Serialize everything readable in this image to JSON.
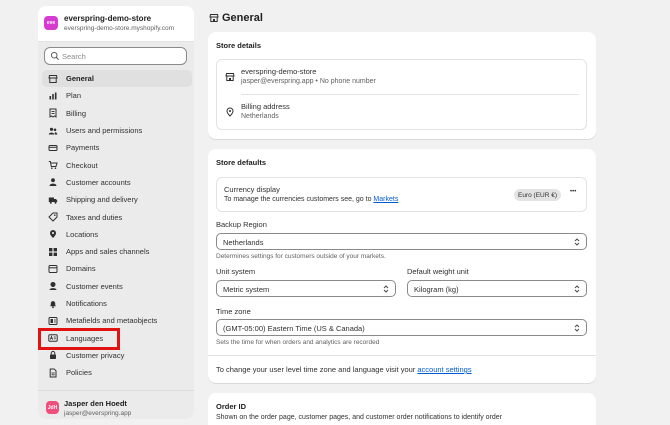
{
  "store": {
    "avatar_text": "eve",
    "name": "everspring-demo-store",
    "url": "everspring-demo-store.myshopify.com"
  },
  "search": {
    "placeholder": "Search"
  },
  "nav": {
    "items": [
      {
        "label": "General",
        "icon": "store-icon",
        "active": true
      },
      {
        "label": "Plan",
        "icon": "chart-icon"
      },
      {
        "label": "Billing",
        "icon": "receipt-icon"
      },
      {
        "label": "Users and permissions",
        "icon": "users-icon"
      },
      {
        "label": "Payments",
        "icon": "payments-icon"
      },
      {
        "label": "Checkout",
        "icon": "cart-icon"
      },
      {
        "label": "Customer accounts",
        "icon": "person-icon"
      },
      {
        "label": "Shipping and delivery",
        "icon": "truck-icon"
      },
      {
        "label": "Taxes and duties",
        "icon": "tax-icon"
      },
      {
        "label": "Locations",
        "icon": "location-icon"
      },
      {
        "label": "Apps and sales channels",
        "icon": "apps-icon"
      },
      {
        "label": "Domains",
        "icon": "globe-icon"
      },
      {
        "label": "Customer events",
        "icon": "events-icon"
      },
      {
        "label": "Notifications",
        "icon": "bell-icon"
      },
      {
        "label": "Metafields and metaobjects",
        "icon": "metafields-icon"
      },
      {
        "label": "Languages",
        "icon": "languages-icon"
      },
      {
        "label": "Customer privacy",
        "icon": "lock-icon"
      },
      {
        "label": "Policies",
        "icon": "policy-icon"
      }
    ]
  },
  "user": {
    "avatar_text": "JdH",
    "name": "Jasper den Hoedt",
    "email": "jasper@everspring.app"
  },
  "page": {
    "title": "General"
  },
  "store_details": {
    "title": "Store details",
    "store_name": "everspring-demo-store",
    "contact": "jasper@everspring.app • No phone number",
    "billing_label": "Billing address",
    "billing_value": "Netherlands"
  },
  "store_defaults": {
    "title": "Store defaults",
    "currency_title": "Currency display",
    "currency_desc": "To manage the currencies customers see, go to ",
    "currency_link": "Markets",
    "currency_badge": "Euro (EUR €)",
    "more_label": "•••",
    "backup_label": "Backup Region",
    "backup_value": "Netherlands",
    "backup_help": "Determines settings for customers outside of your markets.",
    "unit_label": "Unit system",
    "unit_value": "Metric system",
    "weight_label": "Default weight unit",
    "weight_value": "Kilogram (kg)",
    "tz_label": "Time zone",
    "tz_value": "(GMT-05:00) Eastern Time (US & Canada)",
    "tz_help": "Sets the time for when orders and analytics are recorded",
    "footer_text": "To change your user level time zone and language visit your ",
    "footer_link": "account settings"
  },
  "order_id": {
    "title": "Order ID",
    "desc": "Shown on the order page, customer pages, and customer order notifications to identify order"
  },
  "colors": {
    "highlight": "#e01212",
    "link": "#005bd3",
    "store_avatar": "#d63bd1",
    "user_avatar": "#f04e7c"
  }
}
